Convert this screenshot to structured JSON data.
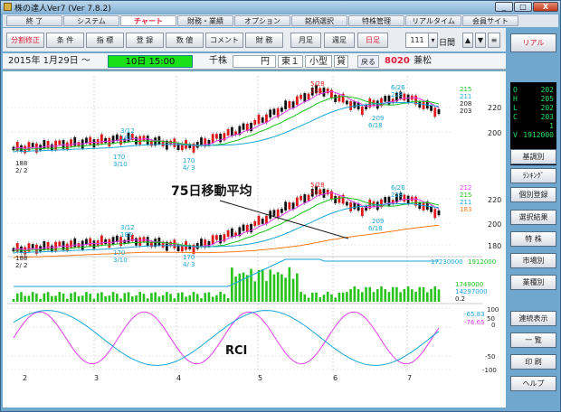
{
  "window": {
    "title": "株の達人Ver7 (Ver 7.8.2)",
    "min_label": "_",
    "max_label": "□",
    "close_label": "X"
  },
  "menu": [
    "終 了",
    "システム",
    "チャート",
    "財務・業績",
    "オプション",
    "銘柄選択",
    "特株管理",
    "リアルタイム",
    "会員サイト"
  ],
  "toolbar": {
    "buttons": [
      "分割修正",
      "条 件",
      "指 標",
      "登 録",
      "数 値",
      "コメント",
      "財 務",
      "月足",
      "週足",
      "日足"
    ],
    "days_value": "111",
    "days_unit": "日間"
  },
  "info": {
    "date": "2015年 1月29日 ～",
    "time_box": "10日 15:00",
    "unit_label": "千株",
    "currency": "円",
    "market": "東１",
    "category": "小型",
    "margin": "貸",
    "back_btn": "戻る",
    "code": "8020",
    "name": "兼松"
  },
  "right_panel": {
    "real_btn": "リアル",
    "ohlc": [
      {
        "k": "O",
        "v": "202"
      },
      {
        "k": "H",
        "v": "205"
      },
      {
        "k": "L",
        "v": "202"
      },
      {
        "k": "C",
        "v": "203"
      },
      {
        "k": "",
        "v": "1"
      },
      {
        "k": "V",
        "v": "1912000"
      }
    ],
    "buttons": [
      "基調別",
      "ﾗﾝｷﾝｸﾞ",
      "個別登録",
      "選択結果",
      "特 株",
      "市場別",
      "業種別",
      "連続表示",
      "一 覧",
      "印 刷",
      "ヘルプ"
    ]
  },
  "colors": {
    "candle_up": "#e01818",
    "candle_down": "#111111",
    "ma_short": "#e03cf0",
    "ma_mid": "#19c21c",
    "ma_long": "#1aa6d8",
    "ma_75": "#ff7a18",
    "volume": "#27c21c",
    "rci_short": "#e03cf0",
    "rci_long": "#1aa6d8"
  },
  "chart": {
    "annotation": "75日移動平均",
    "rci_label": "RCI",
    "top_ma_values": [
      "215",
      "211",
      "208",
      "203"
    ],
    "mid_ma_values": [
      "212",
      "215",
      "211",
      "183"
    ],
    "price_ticks_top": [
      "220",
      "200"
    ],
    "price_ticks_mid": [
      "220",
      "200",
      "180"
    ],
    "vol_ma_values": [
      "17230000",
      "1912000"
    ],
    "vol_values": [
      "1749000",
      "14297000",
      "0.2"
    ],
    "vol_ticks": [
      "100",
      "50",
      "0"
    ],
    "rci_values": [
      "-65.83",
      "-76.65"
    ],
    "rci_ticks": [
      "100",
      "50",
      "0",
      "-50",
      "-100"
    ],
    "x_ticks": [
      "2",
      "3",
      "4",
      "5",
      "6",
      "7"
    ],
    "labels": {
      "low_price": "188",
      "low_date": "2/ 2",
      "hi1_date": "3/12",
      "hi1_price": "185",
      "lo2_price": "170",
      "lo2_date": "3/10",
      "lo3_price": "170",
      "lo3_date": "4/ 3",
      "peak_date": "5/28",
      "peak_price": "234",
      "hi2_date": "6/26",
      "hi2_price": "228",
      "lo4_price": "209",
      "lo4_date": "6/18"
    }
  }
}
